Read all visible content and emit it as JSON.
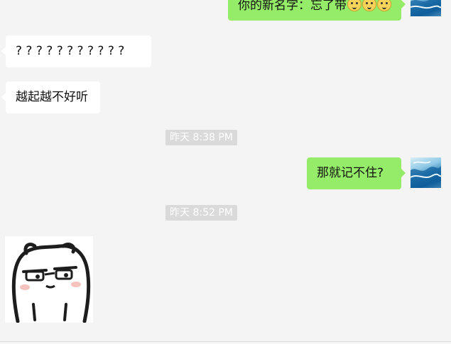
{
  "messages": {
    "m1": {
      "text": "你的新名字：忘了带",
      "emoji": "dog-face-emoji"
    },
    "m2": {
      "text": "? ? ? ? ? ? ? ? ? ? ?"
    },
    "m3": {
      "text": "越起越不好听"
    },
    "t1": {
      "text": "昨天 8:38 PM"
    },
    "m4": {
      "text": "那就记不住?"
    },
    "t2": {
      "text": "昨天 8:52 PM"
    },
    "m5": {
      "sticker": "cartoon-bear-sticker"
    }
  },
  "colors": {
    "background": "#f4f4f4",
    "incoming_bubble": "#ffffff",
    "outgoing_bubble": "#95ec69",
    "timestamp_bg": "#dadada"
  }
}
